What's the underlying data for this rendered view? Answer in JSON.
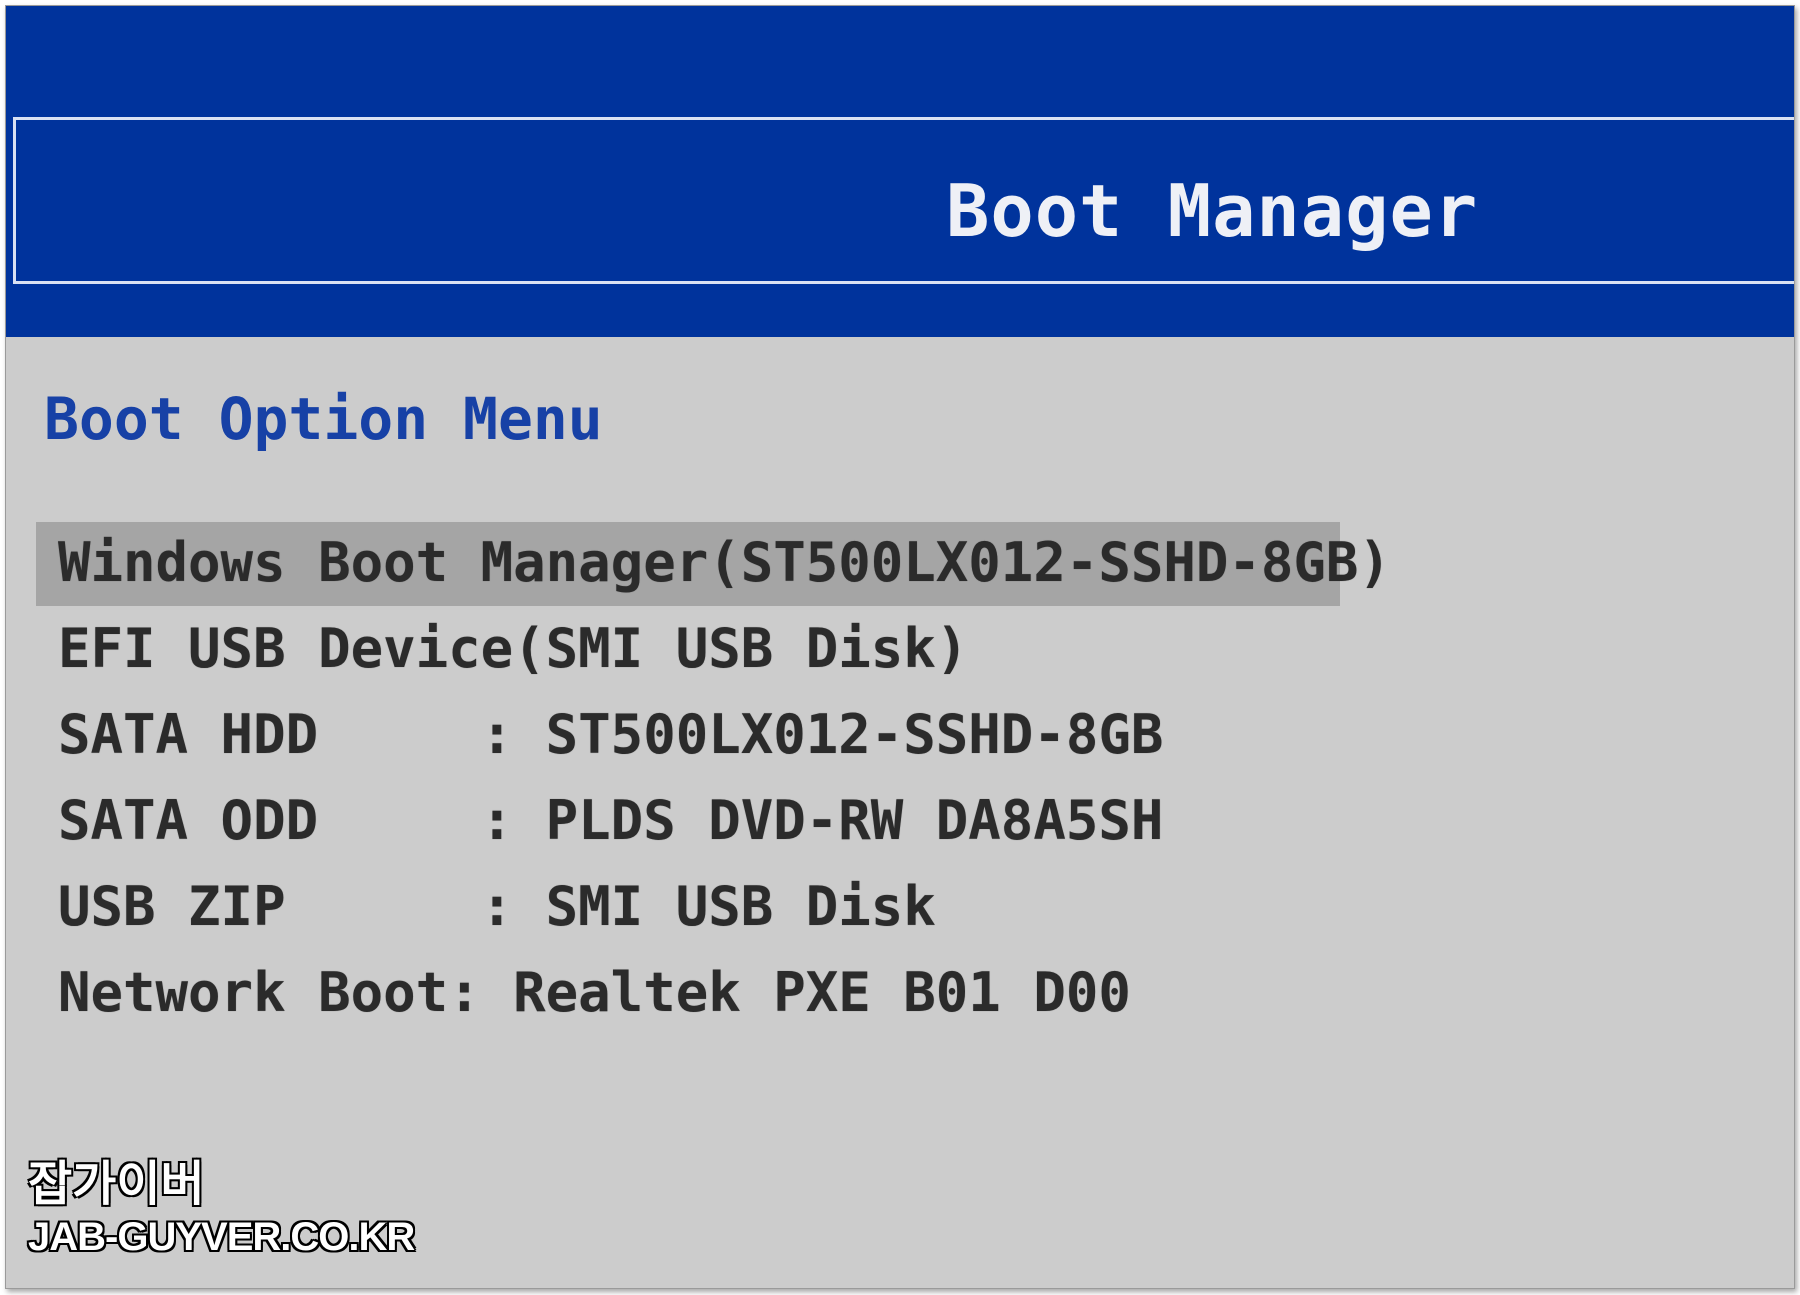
{
  "header": {
    "title": "Boot Manager",
    "background_color": "#00339c"
  },
  "menu": {
    "heading": "Boot Option Menu",
    "selected_index": 0,
    "selection_color": "#a5a5a5",
    "items": [
      {
        "label": "Windows Boot Manager(ST500LX012-SSHD-8GB)"
      },
      {
        "label": "EFI USB Device(SMI USB Disk)"
      },
      {
        "label": "SATA HDD     : ST500LX012-SSHD-8GB"
      },
      {
        "label": "SATA ODD     : PLDS DVD-RW DA8A5SH"
      },
      {
        "label": "USB ZIP      : SMI USB Disk"
      },
      {
        "label": "Network Boot: Realtek PXE B01 D00"
      }
    ]
  },
  "watermark": {
    "line1": "잡가이버",
    "line2": "JAB-GUYVER.CO.KR"
  }
}
